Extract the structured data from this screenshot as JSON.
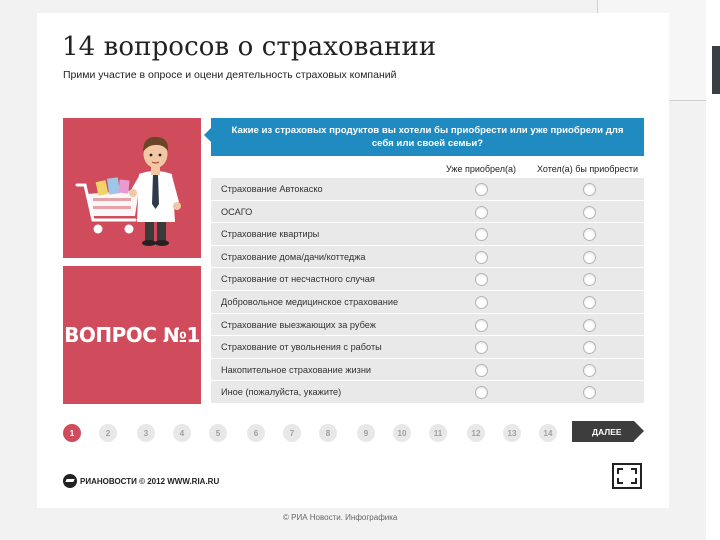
{
  "header": {
    "title": "14 вопросов о страховании",
    "subtitle": "Прими участие в опросе и оцени деятельность страховых компаний"
  },
  "sidebar": {
    "question_label": "ВОПРОС №1"
  },
  "question": {
    "text": "Какие из страховых продуктов вы хотели бы приобрести или уже приобрели для себя или своей семьи?",
    "columns": [
      "Уже приобрел(а)",
      "Хотел(а) бы приобрести"
    ],
    "options": [
      "Страхование Автокаско",
      "ОСАГО",
      "Страхование квартиры",
      "Страхование дома/дачи/коттеджа",
      "Страхование от несчастного случая",
      "Добровольное медицинское страхование",
      "Страхование выезжающих за рубеж",
      "Страхование от увольнения с работы",
      "Накопительное страхование жизни",
      "Иное (пожалуйста, укажите)"
    ]
  },
  "pagination": {
    "pages": [
      "1",
      "2",
      "3",
      "4",
      "5",
      "6",
      "7",
      "8",
      "9",
      "10",
      "11",
      "12",
      "13",
      "14"
    ],
    "current": "1",
    "next_label": "ДАЛЕЕ"
  },
  "footer": {
    "logo_text": "РИАНОВОСТИ © 2012 WWW.RIA.RU",
    "credit": "© РИА Новости. Инфографика"
  },
  "colors": {
    "accent": "#d04b5c",
    "question_bar": "#1f8bc0",
    "row_bg": "#e9e9e9",
    "button_dark": "#3d3d3d"
  },
  "icons": {
    "hero": "shopper-with-cart-illustration",
    "fullscreen": "fullscreen-icon",
    "logo": "ria-novosti-logo"
  }
}
